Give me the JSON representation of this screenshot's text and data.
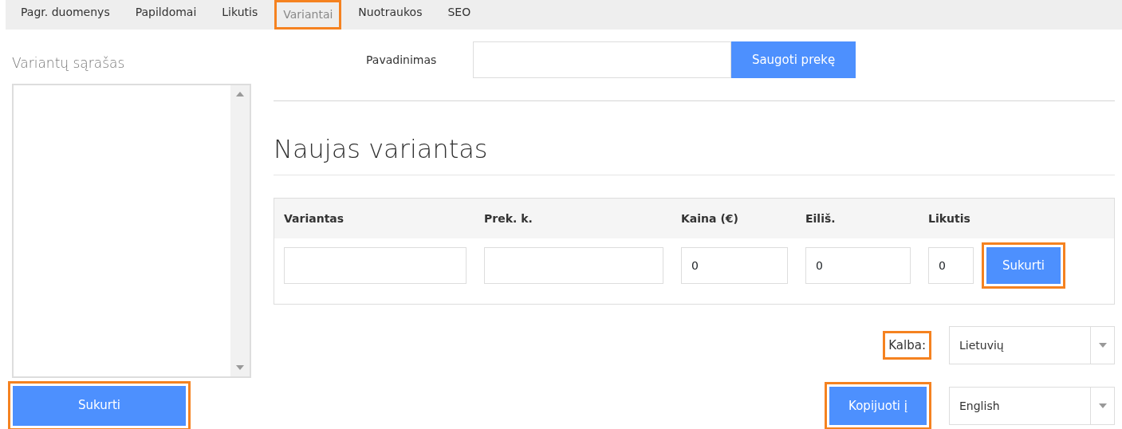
{
  "tabs": [
    {
      "label": "Pagr. duomenys",
      "selected": false,
      "highlighted": false
    },
    {
      "label": "Papildomai",
      "selected": false,
      "highlighted": false
    },
    {
      "label": "Likutis",
      "selected": false,
      "highlighted": false
    },
    {
      "label": "Variantai",
      "selected": true,
      "highlighted": true
    },
    {
      "label": "Nuotraukos",
      "selected": false,
      "highlighted": false
    },
    {
      "label": "SEO",
      "selected": false,
      "highlighted": false
    }
  ],
  "variants_list": {
    "title": "Variantų sąrašas",
    "create_button": {
      "label": "Sukurti",
      "highlighted": true
    }
  },
  "name_field": {
    "label": "Pavadinimas",
    "save_button": "Saugoti prekę"
  },
  "new_variant": {
    "heading": "Naujas variantas",
    "columns": [
      {
        "label": "Variantas"
      },
      {
        "label": "Prek. k."
      },
      {
        "label": "Kaina (€)",
        "value": "0"
      },
      {
        "label": "Eiliš.",
        "value": "0"
      },
      {
        "label": "Likutis",
        "value": "0"
      }
    ],
    "create_button": {
      "label": "Sukurti",
      "highlighted": true
    }
  },
  "language": {
    "label": "Kalba:",
    "label_highlighted": true,
    "value": "Lietuvių"
  },
  "copy": {
    "button": "Kopijuoti į",
    "highlighted": true,
    "value": "English"
  }
}
